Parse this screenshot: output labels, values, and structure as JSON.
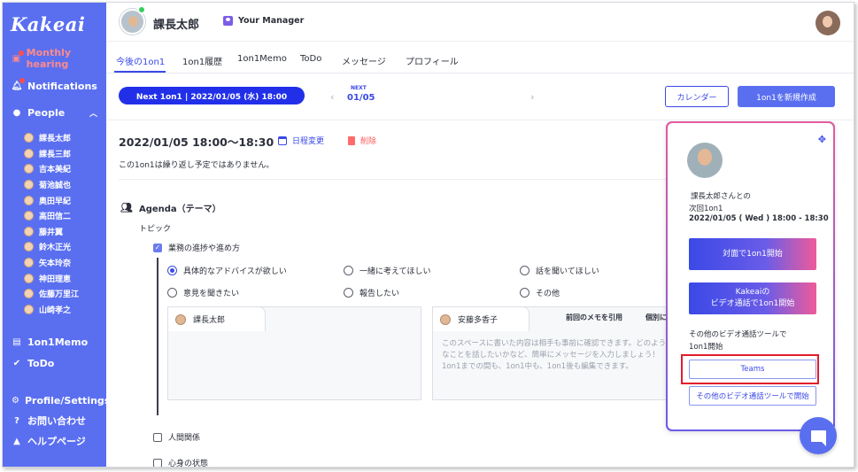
{
  "app": {
    "logo": "Kakeai"
  },
  "sidebar": {
    "monthly_hearing": "Monthly hearing",
    "notifications": "Notifications",
    "people": "People",
    "people_list": [
      "課長太郎",
      "課長三郎",
      "吉本美紀",
      "菊池誠也",
      "奥田早紀",
      "高田信二",
      "藤井翼",
      "鈴木正光",
      "矢本玲奈",
      "神田理恵",
      "佐藤万里江",
      "山崎孝之"
    ],
    "memo": "1on1Memo",
    "todo": "ToDo",
    "profile_settings": "Profile/Settings",
    "contact": "お問い合わせ",
    "help": "ヘルプページ"
  },
  "header": {
    "user_name": "課長太郎",
    "manager_label": "Your Manager"
  },
  "tabs": [
    "今後の1on1",
    "1on1履歴",
    "1on1Memo",
    "ToDo",
    "メッセージ",
    "プロフィール"
  ],
  "next_bar": {
    "pill": "Next 1on1 | 2022/01/05 (水) 18:00",
    "next_label": "NEXT",
    "next_date": "01/05",
    "prev_arrow": "‹",
    "next_arrow": "›",
    "calendar_button": "カレンダー",
    "new_button": "1on1を新規作成"
  },
  "meeting": {
    "time": "2022/01/05  18:00〜18:30",
    "reschedule": "日程変更",
    "delete": "削除",
    "repeat_note": "この1on1は繰り返し予定ではありません。"
  },
  "agenda": {
    "title": "Agenda（テーマ）",
    "topic_label": "トピック",
    "topics": {
      "work_progress": "業務の進捗や進め方",
      "relations": "人間関係",
      "wellbeing": "心身の状態"
    },
    "options": [
      "具体的なアドバイスが欲しい",
      "一緒に考えてほしい",
      "話を聞いてほしい",
      "意見を聞きたい",
      "報告したい",
      "その他"
    ]
  },
  "memo": {
    "left_tab": "課長太郎",
    "right_tab": "安藤多香子",
    "quote_prev": "前回のメモを引用",
    "individual": "個別に",
    "placeholder": "このスペースに書いた内容は相手も事前に確認できます。どのようなことを話したいかなど、簡単にメッセージを入力しましょう！1on1までの間も、1on1中も、1on1後も編集できます。"
  },
  "card": {
    "grip": "✥",
    "line1": "課長太郎さんとの",
    "line2": "次回1on1",
    "datetime": "2022/01/05 ( Wed ) 18:00 - 18:30",
    "face_to_face": "対面で1on1開始",
    "kakeai_video_1": "Kakeaiの",
    "kakeai_video_2": "ビデオ通話で1on1開始",
    "other_tools_1": "その他のビデオ通話ツールで",
    "other_tools_2": "1on1開始",
    "teams": "Teams",
    "other_tool_btn": "その他のビデオ通話ツールで開始"
  },
  "colors": {
    "sidebar": "#5a6ff0",
    "accent": "#3a49e6",
    "highlight": "#e21d2a"
  }
}
